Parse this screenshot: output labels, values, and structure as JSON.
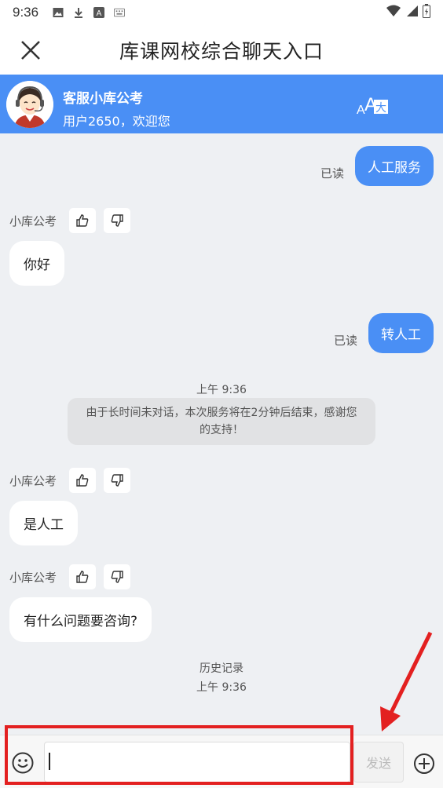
{
  "status_bar": {
    "time": "9:36",
    "icons": [
      "image-icon",
      "download-icon",
      "a-icon",
      "keyboard-icon",
      "wifi-icon",
      "signal-icon",
      "battery-icon"
    ]
  },
  "header": {
    "title": "库课网校综合聊天入口",
    "close_icon": "close-icon"
  },
  "agent": {
    "name": "客服小库公考",
    "subtitle": "用户2650，欢迎您",
    "translate_icon": "translate-icon",
    "color": "#4a8ff5"
  },
  "messages": {
    "m1": {
      "text": "人工服务",
      "status": "已读"
    },
    "m2": {
      "sender": "小库公考",
      "text": "你好"
    },
    "m3": {
      "text": "转人工",
      "status": "已读"
    },
    "t1": {
      "time": "上午 9:36"
    },
    "notice": {
      "text": "由于长时间未对话，本次服务将在2分钟后结束，感谢您的支持！"
    },
    "m4": {
      "sender": "小库公考",
      "text": "是人工"
    },
    "m5": {
      "sender": "小库公考",
      "text": "有什么问题要咨询?"
    },
    "history": {
      "label": "历史记录",
      "time": "上午 9:36"
    }
  },
  "input_bar": {
    "emoji_icon": "emoji-icon",
    "input_value": "",
    "send_label": "发送",
    "plus_icon": "plus-circle-icon"
  },
  "annotation": {
    "highlight_color": "#e32020"
  }
}
